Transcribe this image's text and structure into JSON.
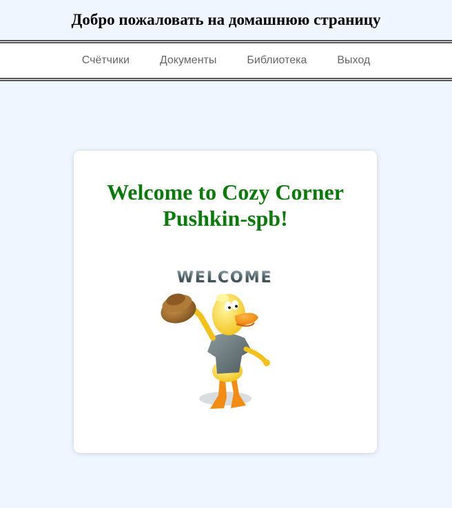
{
  "header": {
    "title": "Добро пожаловать на домашнюю страницу"
  },
  "nav": {
    "items": [
      {
        "label": "Счётчики"
      },
      {
        "label": "Документы"
      },
      {
        "label": "Библиотека"
      },
      {
        "label": "Выход"
      }
    ]
  },
  "card": {
    "title": "Welcome to Cozy Corner Pushkin-spb!",
    "graphic_text": "WELCOME"
  },
  "colors": {
    "page_bg": "#f0f6ff",
    "title_green": "#0a7a0a",
    "nav_text": "#666666"
  }
}
